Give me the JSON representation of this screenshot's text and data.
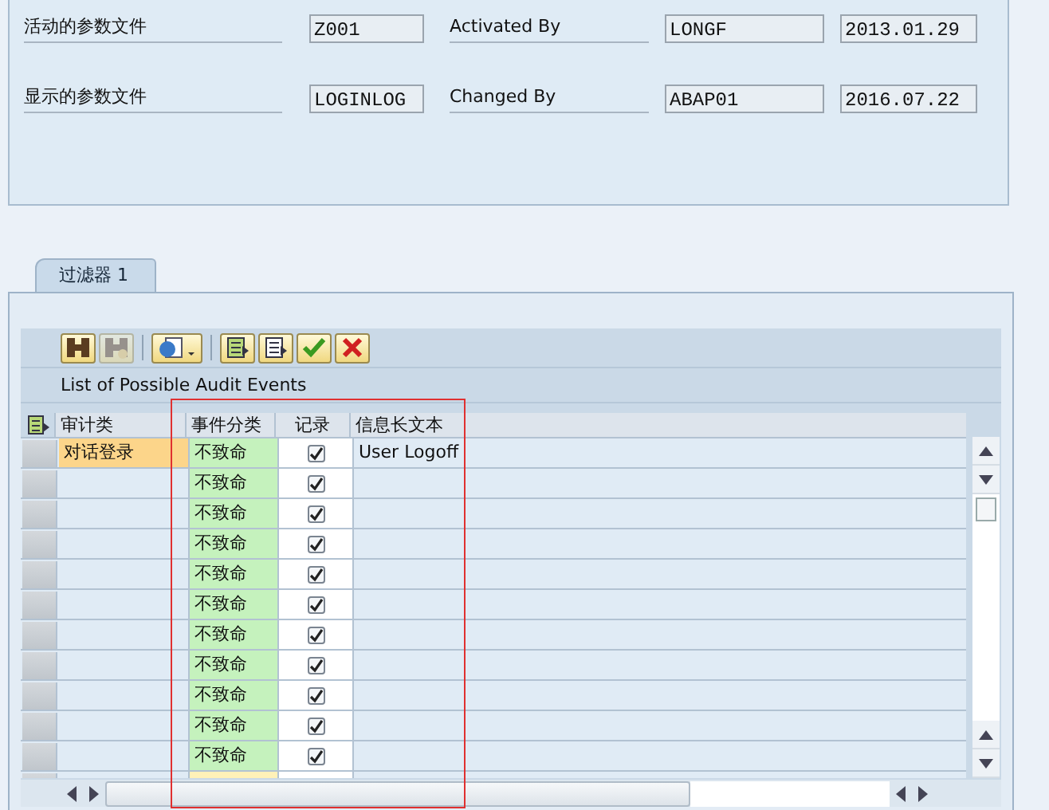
{
  "header": {
    "rows": [
      {
        "label": "活动的参数文件",
        "profile": "Z001",
        "by_label": "Activated By",
        "by": "LONGF",
        "date": "2013.01.29"
      },
      {
        "label": "显示的参数文件",
        "profile": "LOGINLOG",
        "by_label": "Changed By",
        "by": "ABAP01",
        "date": "2016.07.22"
      }
    ]
  },
  "tabs": [
    {
      "label": "过滤器 1",
      "selected": true
    }
  ],
  "toolbar": [
    {
      "kind": "find",
      "disabled": false
    },
    {
      "kind": "find_next",
      "disabled": true
    },
    {
      "kind": "details",
      "disabled": false
    },
    {
      "kind": "export",
      "disabled": false
    },
    {
      "kind": "import",
      "disabled": false
    },
    {
      "kind": "confirm",
      "disabled": false
    },
    {
      "kind": "cancel",
      "disabled": false
    }
  ],
  "table": {
    "title": "List of Possible Audit Events",
    "columns": [
      "审计类",
      "事件分类",
      "记录",
      "信息长文本"
    ],
    "rows": [
      {
        "audit_class": "对话登录",
        "category": "不致命",
        "record": true,
        "text": "User Logoff"
      },
      {
        "category": "不致命",
        "record": true
      },
      {
        "category": "不致命",
        "record": true
      },
      {
        "category": "不致命",
        "record": true
      },
      {
        "category": "不致命",
        "record": true
      },
      {
        "category": "不致命",
        "record": true
      },
      {
        "category": "不致命",
        "record": true
      },
      {
        "category": "不致命",
        "record": true
      },
      {
        "category": "不致命",
        "record": true
      },
      {
        "category": "不致命",
        "record": true
      },
      {
        "category": "不致命",
        "record": true
      }
    ]
  }
}
